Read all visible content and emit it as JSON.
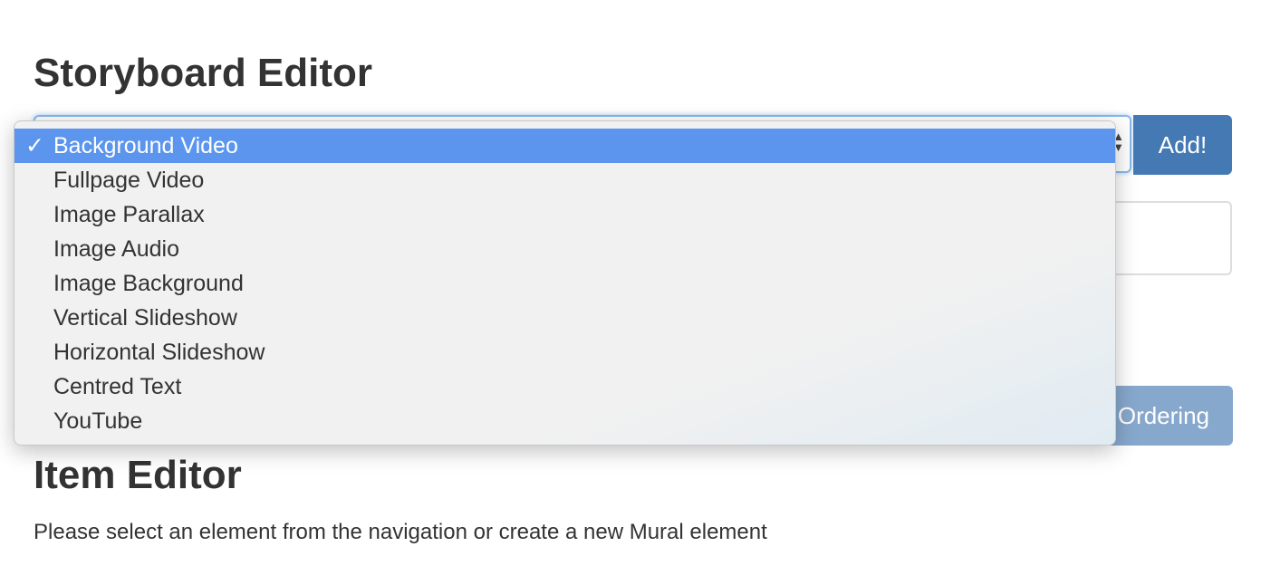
{
  "header": {
    "title": "Storyboard Editor"
  },
  "add_button": "Add!",
  "ordering_button": "Ordering",
  "dropdown": {
    "selected": "Background Video",
    "check": "✓",
    "options": [
      "Background Video",
      "Fullpage Video",
      "Image Parallax",
      "Image Audio",
      "Image Background",
      "Vertical Slideshow",
      "Horizontal Slideshow",
      "Centred Text",
      "YouTube"
    ],
    "highlight_color": "#5b95ee"
  },
  "item_editor": {
    "title": "Item Editor",
    "message": "Please select an element from the navigation or create a new Mural element"
  }
}
